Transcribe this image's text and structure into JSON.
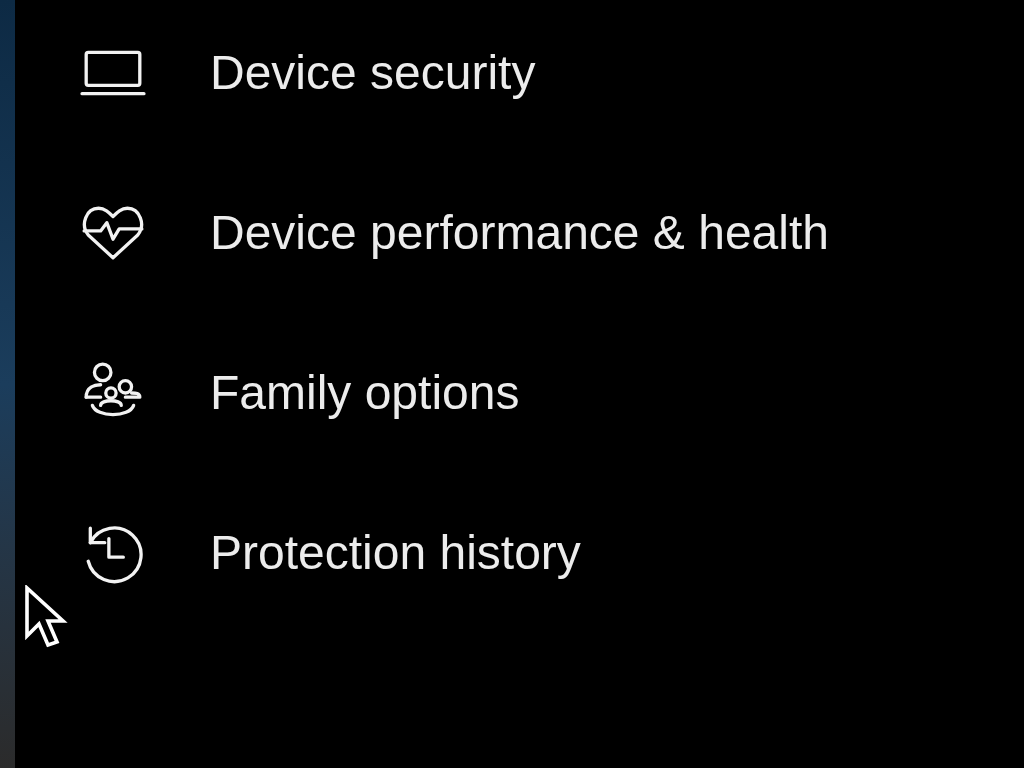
{
  "nav_items": [
    {
      "kind": "laptop",
      "label": "Device security"
    },
    {
      "kind": "heart",
      "label": "Device performance & health"
    },
    {
      "kind": "family",
      "label": "Family options"
    },
    {
      "kind": "history",
      "label": "Protection history"
    }
  ]
}
